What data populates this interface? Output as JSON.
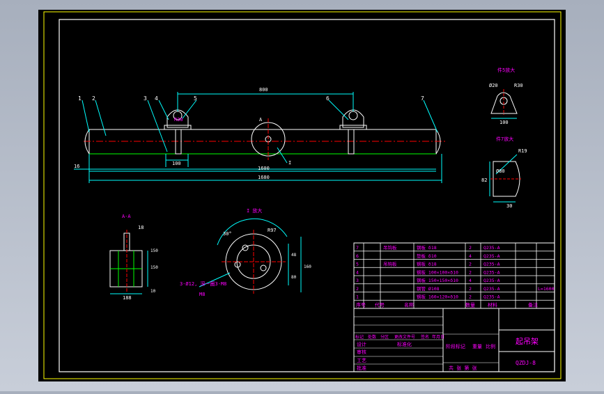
{
  "drawing": {
    "balloons": [
      "1",
      "2",
      "3",
      "4",
      "5",
      "6",
      "7"
    ],
    "dim_top": "800",
    "dim_left": "16",
    "dim_1600": "1600",
    "dim_1680": "1680",
    "dim_100": "100",
    "dim_r30_short": "R30",
    "center_mark": "A",
    "callout_i": "I"
  },
  "view_5": {
    "title": "件5放大",
    "r": "R30",
    "phi": "Ø20",
    "w": "100"
  },
  "view_7": {
    "title": "件7放大",
    "r": "R19",
    "d": "Ø80",
    "w": "30",
    "h": "82"
  },
  "section_aa": {
    "title": "A-A",
    "w": "188",
    "t": "18",
    "h1": "150",
    "h2": "150",
    "h3": "10"
  },
  "detail_i": {
    "title": "I 放大",
    "a": "R97",
    "b": "30°",
    "c": "48",
    "d": "160",
    "e": "80",
    "note": "3-Ø12, 深一圈3-M8",
    "note2": "M8"
  },
  "bom": {
    "rows": [
      {
        "no": "7",
        "code": "",
        "name": "吊钩板",
        "spec": "钢板 δ18",
        "qty": "2",
        "mat": "Q235-A",
        "note": ""
      },
      {
        "no": "6",
        "code": "",
        "name": "",
        "spec": "垫板 δ10",
        "qty": "4",
        "mat": "Q235-A",
        "note": ""
      },
      {
        "no": "5",
        "code": "",
        "name": "吊钩板",
        "spec": "钢板 δ18",
        "qty": "2",
        "mat": "Q235-A",
        "note": ""
      },
      {
        "no": "4",
        "code": "",
        "name": "",
        "spec": "钢板 100×100×δ10",
        "qty": "2",
        "mat": "Q235-A",
        "note": ""
      },
      {
        "no": "3",
        "code": "",
        "name": "",
        "spec": "钢板 150×150×δ10",
        "qty": "4",
        "mat": "Q235-A",
        "note": ""
      },
      {
        "no": "2",
        "code": "",
        "name": "",
        "spec": "钢管 Ø108",
        "qty": "2",
        "mat": "Q235-A",
        "note": "L=1600"
      },
      {
        "no": "1",
        "code": "",
        "name": "",
        "spec": "钢板 160×120×δ10",
        "qty": "2",
        "mat": "Q235-A",
        "note": ""
      }
    ],
    "headers": [
      "序号",
      "代号",
      "名称",
      "数量",
      "材料",
      "备注"
    ]
  },
  "title_block": {
    "title": "起吊架",
    "code": "QZDJ-8",
    "row_labels": [
      "标记",
      "处数",
      "分区",
      "更改文件号",
      "签名",
      "年月日"
    ],
    "design": "设计",
    "standard": "标准化",
    "check": "审核",
    "process": "工艺",
    "approve": "批准",
    "stage": "阶段标记",
    "weight": "重量",
    "scale": "比例",
    "sheets": "共 张 第 张"
  },
  "colors": {
    "frame": "#ffffff",
    "border": "#ffff00",
    "outline": "#ffffff",
    "dims": "#00ffff",
    "text": "#ff00ff",
    "center": "#ff0000",
    "hatch": "#00ff00"
  }
}
